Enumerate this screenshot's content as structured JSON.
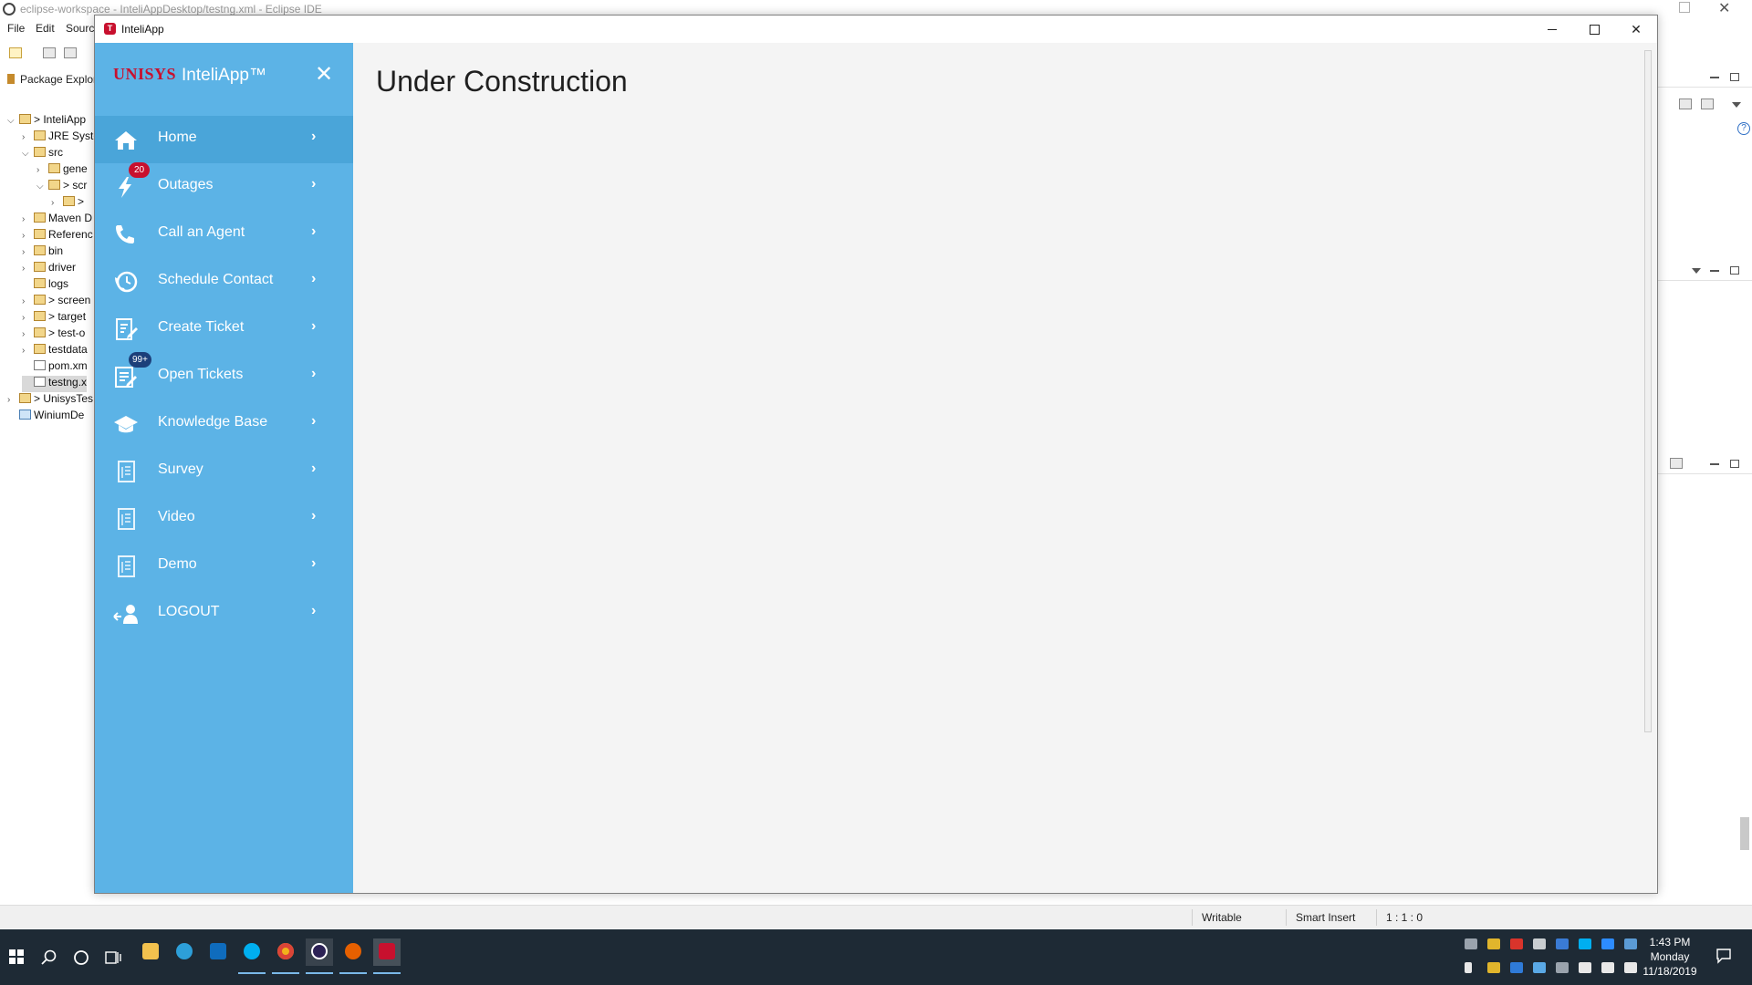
{
  "eclipse": {
    "window_title": "eclipse-workspace - InteliAppDesktop/testng.xml - Eclipse IDE",
    "menu": [
      "File",
      "Edit",
      "Sourc"
    ],
    "package_explorer_title": "Package Explor",
    "tree": [
      {
        "twisty": "⌵",
        "label": "> InteliApp"
      },
      {
        "twisty": "›",
        "label": "JRE Syste"
      },
      {
        "twisty": "⌵",
        "label": "src"
      },
      {
        "twisty": "›",
        "label": "gene"
      },
      {
        "twisty": "⌵",
        "label": "> scr"
      },
      {
        "twisty": "›",
        "label": ">"
      },
      {
        "twisty": "›",
        "label": "Maven D"
      },
      {
        "twisty": "›",
        "label": "Referenc"
      },
      {
        "twisty": "›",
        "label": "bin"
      },
      {
        "twisty": "›",
        "label": "driver"
      },
      {
        "twisty": "",
        "label": "logs"
      },
      {
        "twisty": "›",
        "label": "> screen"
      },
      {
        "twisty": "›",
        "label": "> target"
      },
      {
        "twisty": "›",
        "label": "> test-o"
      },
      {
        "twisty": "›",
        "label": "testdata"
      },
      {
        "twisty": "",
        "label": "pom.xm"
      },
      {
        "twisty": "",
        "label": "testng.x"
      },
      {
        "twisty": "›",
        "label": "> UnisysTes"
      },
      {
        "twisty": "",
        "label": "WiniumDe"
      }
    ],
    "status": {
      "writable": "Writable",
      "insert_mode": "Smart Insert",
      "position": "1 : 1 : 0"
    }
  },
  "app": {
    "window_title": "InteliApp",
    "brand_company": "UNISYS",
    "brand_app": "InteliApp™",
    "page_heading": "Under Construction",
    "nav": [
      {
        "label": "Home",
        "icon": "home-icon",
        "badge": null,
        "active": true
      },
      {
        "label": "Outages",
        "icon": "lightning-icon",
        "badge": "20",
        "active": false
      },
      {
        "label": "Call an Agent",
        "icon": "phone-icon",
        "badge": null,
        "active": false
      },
      {
        "label": "Schedule Contact",
        "icon": "clock-phone-icon",
        "badge": null,
        "active": false
      },
      {
        "label": "Create Ticket",
        "icon": "ticket-edit-icon",
        "badge": null,
        "active": false
      },
      {
        "label": "Open Tickets",
        "icon": "ticket-list-icon",
        "badge": "99+",
        "active": false
      },
      {
        "label": "Knowledge Base",
        "icon": "graduation-cap-icon",
        "badge": null,
        "active": false
      },
      {
        "label": "Survey",
        "icon": "document-icon",
        "badge": null,
        "active": false
      },
      {
        "label": "Video",
        "icon": "document-icon",
        "badge": null,
        "active": false
      },
      {
        "label": "Demo",
        "icon": "document-icon",
        "badge": null,
        "active": false
      },
      {
        "label": "LOGOUT",
        "icon": "logout-user-icon",
        "badge": null,
        "active": false
      }
    ],
    "colors": {
      "sidebar": "#5cb3e6",
      "active_item": "#4aa5d9",
      "badge_red": "#c8102e",
      "badge_navy": "#1c3f7a",
      "brand_red": "#c8102e"
    }
  },
  "taskbar": {
    "apps": [
      "file-explorer-icon",
      "internet-explorer-icon",
      "outlook-icon",
      "skype-icon",
      "chrome-icon",
      "eclipse-icon",
      "firefox-icon",
      "inteliapp-icon"
    ],
    "clock": {
      "time": "1:43 PM",
      "day": "Monday",
      "date": "11/18/2019"
    }
  }
}
